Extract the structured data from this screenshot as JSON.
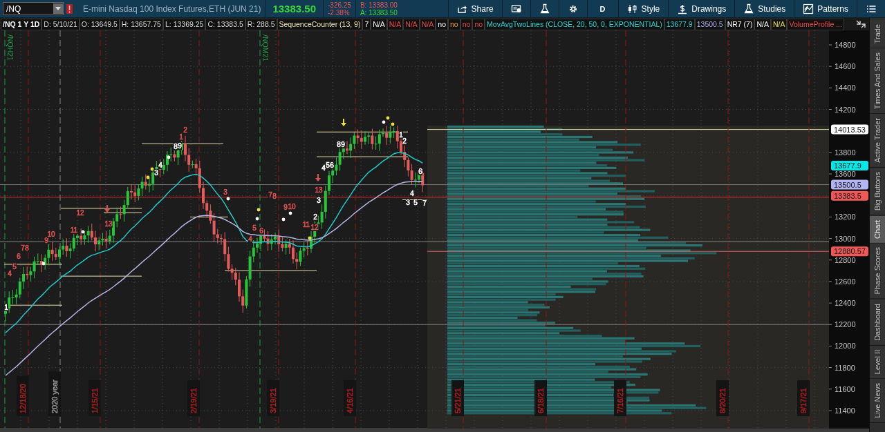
{
  "toolbar": {
    "symbol": "/NQ",
    "description": "E-mini Nasdaq 100 Index Futures,ETH (JUN 21)",
    "last_price": "13383.50",
    "change": "-326.25",
    "change_percent": "-2.38%",
    "bid": "B: 13383.00",
    "ask": "A: 13383.50",
    "buttons": [
      {
        "kind": "share",
        "label": "Share"
      },
      {
        "kind": "news"
      },
      {
        "kind": "flask"
      },
      {
        "kind": "gear"
      },
      {
        "kind": "text",
        "label": "D"
      },
      {
        "kind": "style",
        "label": "Style"
      },
      {
        "kind": "drawings",
        "label": "Drawings"
      },
      {
        "kind": "flask",
        "label": "Studies"
      },
      {
        "kind": "patterns",
        "label": "Patterns"
      },
      {
        "kind": "list"
      }
    ]
  },
  "info_bar": [
    {
      "text": "/NQ 1 Y 1D",
      "kind": "symbol"
    },
    {
      "text": "D: 5/10/21",
      "kind": "field"
    },
    {
      "text": "O: 13649.5",
      "kind": "field"
    },
    {
      "text": "H: 13657.75",
      "kind": "field"
    },
    {
      "text": "L: 13369.25",
      "kind": "field"
    },
    {
      "text": "C: 13383.5",
      "kind": "field"
    },
    {
      "text": "R: 288.5",
      "kind": "field"
    },
    {
      "text": "SequenceCounter (13, 9)",
      "kind": "study"
    },
    {
      "text": "7",
      "kind": "value"
    },
    {
      "text": "N/A",
      "kind": "value"
    },
    {
      "text": "N/A",
      "kind": "alert"
    },
    {
      "text": "N/A",
      "kind": "alert"
    },
    {
      "text": "N/A",
      "kind": "alert"
    },
    {
      "text": "no",
      "kind": "value"
    },
    {
      "text": "no",
      "kind": "warning"
    },
    {
      "text": "no",
      "kind": "alert"
    },
    {
      "text": "no",
      "kind": "alert"
    },
    {
      "text": "MovAvgTwoLines (CLOSE, 20, 50, 0, EXPONENTIAL)",
      "kind": "average"
    },
    {
      "text": "13677.9",
      "kind": "average"
    },
    {
      "text": "13500.5",
      "kind": "slow"
    },
    {
      "text": "NR7 (7)",
      "kind": "value"
    },
    {
      "text": "N/A",
      "kind": "value"
    },
    {
      "text": "N/A",
      "kind": "caution"
    },
    {
      "text": "VolumeProfile ...",
      "kind": "alert"
    }
  ],
  "chart": {
    "contract_labels": [
      "/NQH21",
      "/NQM21"
    ],
    "date_labels": [
      {
        "text": "12/18/20",
        "kind": "date"
      },
      {
        "text": "2020 year",
        "kind": "year"
      },
      {
        "text": "1/15/21",
        "kind": "date"
      },
      {
        "text": "2/19/21",
        "kind": "date"
      },
      {
        "text": "3/19/21",
        "kind": "date"
      },
      {
        "text": "4/16/21",
        "kind": "date"
      },
      {
        "text": "5/21/21",
        "kind": "date"
      },
      {
        "text": "6/18/21",
        "kind": "date"
      },
      {
        "text": "7/16/21",
        "kind": "date"
      },
      {
        "text": "8/20/21",
        "kind": "date"
      },
      {
        "text": "9/17/21",
        "kind": "date"
      }
    ],
    "counter_labels": [
      {
        "text": "4",
        "kind": "countdown"
      },
      {
        "text": "5",
        "kind": "countdown"
      },
      {
        "text": "6",
        "kind": "countdown"
      },
      {
        "text": "7",
        "kind": "countdown"
      },
      {
        "text": "8",
        "kind": "countdown"
      },
      {
        "text": "9",
        "kind": "countdown"
      },
      {
        "text": "10",
        "kind": "countdown"
      },
      {
        "text": "11",
        "kind": "countdown"
      },
      {
        "text": "12",
        "kind": "countdown"
      },
      {
        "text": "13",
        "kind": "countdown"
      },
      {
        "text": "1",
        "kind": "countdown"
      },
      {
        "text": "2",
        "kind": "countdown"
      },
      {
        "text": "3",
        "kind": "countdown"
      },
      {
        "text": "4",
        "kind": "countdown"
      },
      {
        "text": "5",
        "kind": "countdown"
      },
      {
        "text": "6",
        "kind": "countdown"
      },
      {
        "text": "7",
        "kind": "countdown"
      },
      {
        "text": "8",
        "kind": "countdown"
      },
      {
        "text": "9",
        "kind": "countdown"
      },
      {
        "text": "10",
        "kind": "countdown"
      },
      {
        "text": "11",
        "kind": "countdown"
      },
      {
        "text": "12",
        "kind": "countdown"
      },
      {
        "text": "13",
        "kind": "countdown"
      },
      {
        "text": "1",
        "kind": "setup"
      },
      {
        "text": "3",
        "kind": "setup"
      },
      {
        "text": "4",
        "kind": "setup"
      },
      {
        "text": "8",
        "kind": "setup"
      },
      {
        "text": "9",
        "kind": "setup"
      },
      {
        "text": "2",
        "kind": "setup"
      },
      {
        "text": "3",
        "kind": "setup"
      },
      {
        "text": "4",
        "kind": "setup"
      },
      {
        "text": "5",
        "kind": "setup"
      },
      {
        "text": "6",
        "kind": "setup"
      },
      {
        "text": "8",
        "kind": "setup"
      },
      {
        "text": "9",
        "kind": "setup"
      },
      {
        "text": "1",
        "kind": "setup"
      },
      {
        "text": "2",
        "kind": "setup"
      },
      {
        "text": "3",
        "kind": "setup"
      },
      {
        "text": "4",
        "kind": "setup"
      },
      {
        "text": "5",
        "kind": "setup"
      },
      {
        "text": "6",
        "kind": "setup"
      },
      {
        "text": "7",
        "kind": "setup"
      }
    ],
    "price_axis": [
      "14800",
      "14600",
      "14400",
      "14200",
      "13800",
      "13600",
      "13200",
      "13000",
      "12800",
      "12600",
      "12400",
      "12200",
      "12000",
      "11800",
      "11600",
      "11400"
    ],
    "price_markers": [
      {
        "text": "14013.53",
        "color": "#ffffff"
      },
      {
        "text": "13677.9",
        "color": "#00e8e8"
      },
      {
        "text": "13500.5",
        "color": "#b4b4f4"
      },
      {
        "text": "13383.5",
        "color": "#f05858"
      },
      {
        "text": "12880.57",
        "color": "#f05858"
      }
    ]
  },
  "side_tabs": [
    {
      "label": "Trade",
      "selected": false
    },
    {
      "label": "Times And Sales",
      "selected": false
    },
    {
      "label": "Active Trader",
      "selected": false
    },
    {
      "label": "Big Buttons",
      "selected": false
    },
    {
      "label": "Chart",
      "selected": true
    },
    {
      "label": "Phase Scores",
      "selected": false
    },
    {
      "label": "Dashboard",
      "selected": false
    },
    {
      "label": "Level II",
      "selected": false
    },
    {
      "label": "Live News",
      "selected": false
    }
  ]
}
